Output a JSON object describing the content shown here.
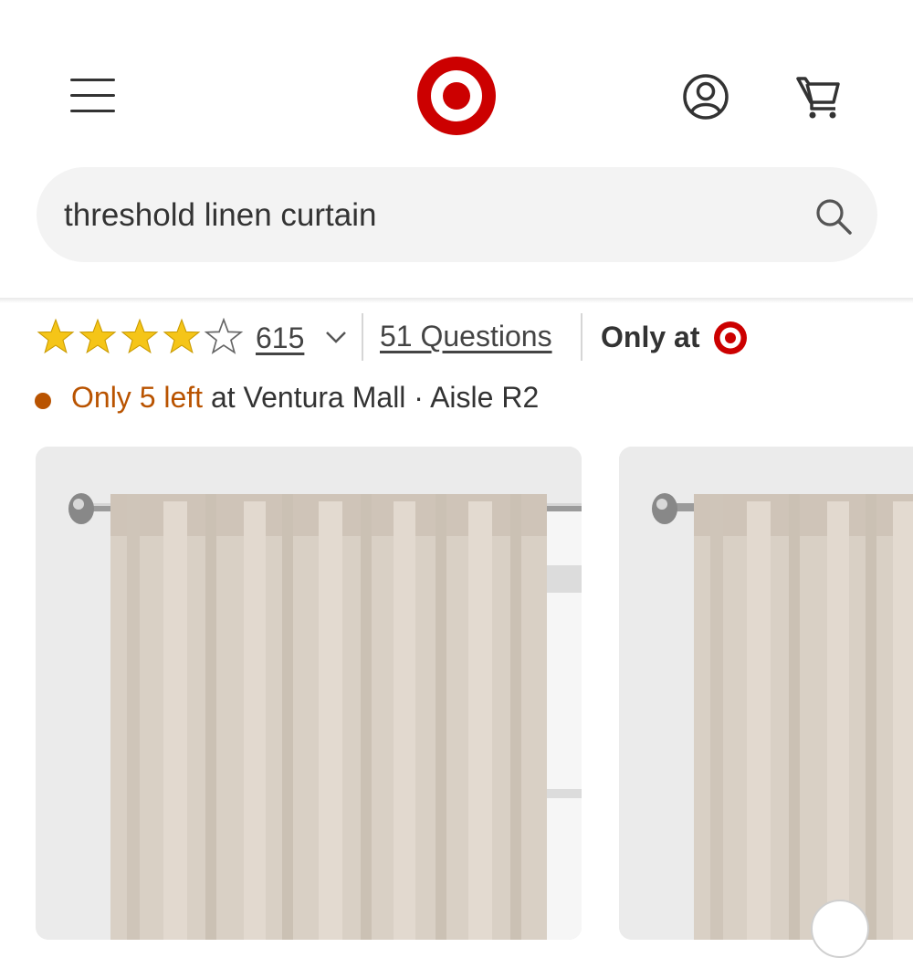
{
  "header": {
    "menu_icon": "hamburger-menu-icon",
    "logo_icon": "target-bullseye-logo",
    "account_icon": "account-user-icon",
    "cart_icon": "shopping-cart-icon",
    "brand_color": "#cc0000"
  },
  "search": {
    "value": "threshold linen curtain",
    "icon": "search-icon"
  },
  "product": {
    "rating": {
      "value": 4,
      "max": 5,
      "review_count": "615",
      "star_color": "#f5c518"
    },
    "questions_label": "51 Questions",
    "exclusive_label": "Only at",
    "stock": {
      "warning": "Only 5 left",
      "location": " at Ventura Mall · Aisle R2",
      "status_color": "#b95300"
    },
    "images": [
      {
        "subject": "linen curtain panel on rod"
      },
      {
        "subject": "linen curtain panel on rod"
      }
    ]
  }
}
